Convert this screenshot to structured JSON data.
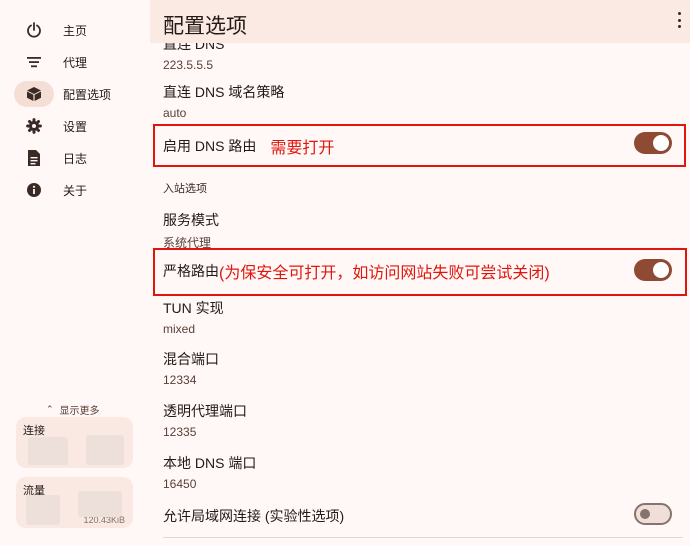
{
  "app": {
    "title": "配置选项"
  },
  "sidebar": {
    "items": [
      {
        "label": "主页",
        "icon": "power-icon",
        "active": false
      },
      {
        "label": "代理",
        "icon": "filter-list-icon",
        "active": false
      },
      {
        "label": "配置选项",
        "icon": "package-icon",
        "active": true
      },
      {
        "label": "设置",
        "icon": "gear-icon",
        "active": false
      },
      {
        "label": "日志",
        "icon": "document-icon",
        "active": false
      },
      {
        "label": "关于",
        "icon": "info-icon",
        "active": false
      }
    ],
    "show_more": "显示更多",
    "stats": [
      {
        "title": "连接",
        "value": ""
      },
      {
        "title": "流量",
        "value": "120.43KiB"
      }
    ]
  },
  "settings": {
    "direct_dns": {
      "title": "直连 DNS",
      "value": "223.5.5.5"
    },
    "direct_dns_strategy": {
      "title": "直连 DNS 域名策略",
      "value": "auto"
    },
    "enable_dns_routing": {
      "title": "启用 DNS 路由",
      "annotation": "需要打开",
      "enabled": true
    },
    "inbound_section": "入站选项",
    "service_mode": {
      "title": "服务模式",
      "value": "系统代理"
    },
    "strict_route": {
      "title": "严格路由",
      "annotation": "(为保安全可打开，如访问网站失败可尝试关闭)",
      "enabled": true
    },
    "tun_impl": {
      "title": "TUN 实现",
      "value": "mixed"
    },
    "mixed_port": {
      "title": "混合端口",
      "value": "12334"
    },
    "transparent_port": {
      "title": "透明代理端口",
      "value": "12335"
    },
    "local_dns_port": {
      "title": "本地 DNS 端口",
      "value": "16450"
    },
    "allow_lan": {
      "title": "允许局域网连接 (实验性选项)",
      "enabled": false
    }
  },
  "colors": {
    "accent": "#8f4a33",
    "annotation_red": "#e0160e",
    "background": "#fff8f6"
  }
}
